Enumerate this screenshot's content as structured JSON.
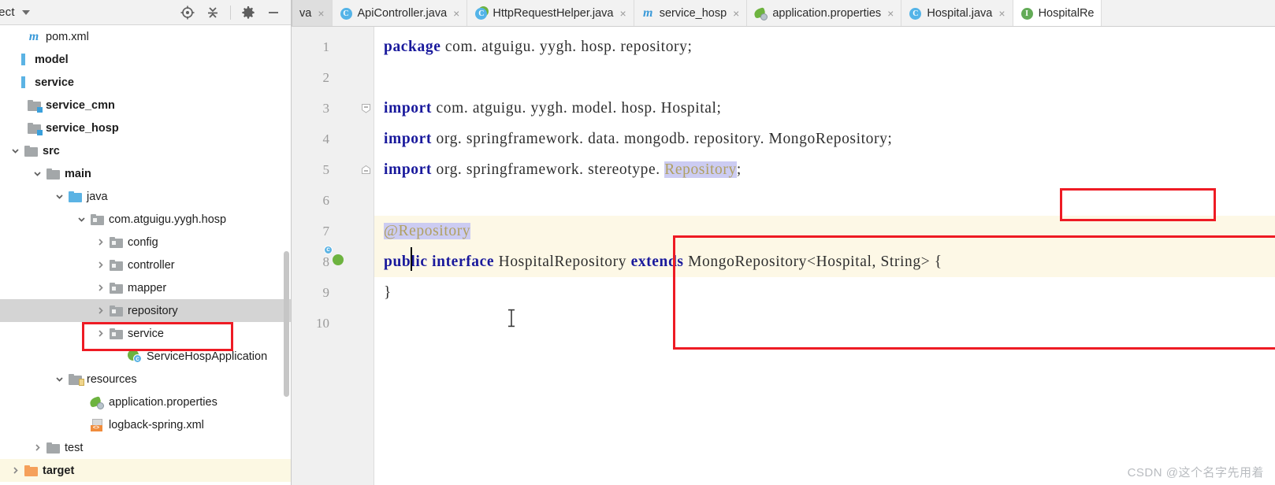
{
  "project_panel": {
    "title": "oject",
    "tools": [
      {
        "name": "locate-icon",
        "label": "Select Opened File"
      },
      {
        "name": "collapse-all-icon",
        "label": "Collapse All"
      },
      {
        "name": "settings-icon",
        "label": "Settings"
      },
      {
        "name": "hide-icon",
        "label": "Hide"
      }
    ],
    "tree": [
      {
        "label": "pom.xml",
        "icon": "maven-file-icon",
        "indent": 14,
        "arrow": "none",
        "bold": false,
        "state": "normal"
      },
      {
        "label": "model",
        "icon": "module-icon",
        "indent": -4,
        "arrow": "none",
        "bold": true,
        "state": "normal"
      },
      {
        "label": "service",
        "icon": "module-icon",
        "indent": -4,
        "arrow": "none",
        "bold": true,
        "state": "normal"
      },
      {
        "label": "service_cmn",
        "icon": "folder-module-icon",
        "indent": 14,
        "arrow": "none",
        "bold": true,
        "state": "normal"
      },
      {
        "label": "service_hosp",
        "icon": "folder-module-icon",
        "indent": 14,
        "arrow": "none",
        "bold": true,
        "state": "normal"
      },
      {
        "label": "src",
        "icon": "folder-icon",
        "indent": 10,
        "arrow": "down",
        "bold": true,
        "state": "normal"
      },
      {
        "label": "main",
        "icon": "folder-icon",
        "indent": 38,
        "arrow": "down",
        "bold": true,
        "state": "normal"
      },
      {
        "label": "java",
        "icon": "folder-source-icon",
        "indent": 66,
        "arrow": "down",
        "bold": false,
        "state": "normal"
      },
      {
        "label": "com.atguigu.yygh.hosp",
        "icon": "package-icon",
        "indent": 94,
        "arrow": "down",
        "bold": false,
        "state": "normal"
      },
      {
        "label": "config",
        "icon": "package-icon",
        "indent": 118,
        "arrow": "right",
        "bold": false,
        "state": "normal"
      },
      {
        "label": "controller",
        "icon": "package-icon",
        "indent": 118,
        "arrow": "right",
        "bold": false,
        "state": "normal"
      },
      {
        "label": "mapper",
        "icon": "package-icon",
        "indent": 118,
        "arrow": "right",
        "bold": false,
        "state": "normal"
      },
      {
        "label": "repository",
        "icon": "package-icon",
        "indent": 118,
        "arrow": "right",
        "bold": false,
        "state": "selected"
      },
      {
        "label": "service",
        "icon": "package-icon",
        "indent": 118,
        "arrow": "right",
        "bold": false,
        "state": "normal"
      },
      {
        "label": "ServiceHospApplication",
        "icon": "spring-boot-icon",
        "indent": 142,
        "arrow": "none",
        "bold": false,
        "state": "normal"
      },
      {
        "label": "resources",
        "icon": "folder-resource-icon",
        "indent": 66,
        "arrow": "down",
        "bold": false,
        "state": "normal"
      },
      {
        "label": "application.properties",
        "icon": "spring-leaf-icon",
        "indent": 94,
        "arrow": "none",
        "bold": false,
        "state": "normal"
      },
      {
        "label": "logback-spring.xml",
        "icon": "xml-file-icon",
        "indent": 94,
        "arrow": "none",
        "bold": false,
        "state": "normal"
      },
      {
        "label": "test",
        "icon": "folder-icon",
        "indent": 38,
        "arrow": "right",
        "bold": false,
        "state": "normal"
      },
      {
        "label": "target",
        "icon": "folder-target-icon",
        "indent": 10,
        "arrow": "right",
        "bold": true,
        "state": "target"
      }
    ]
  },
  "editor": {
    "tabs": [
      {
        "label": "va",
        "icon": "none",
        "active": false,
        "clipped": true,
        "closable": true
      },
      {
        "label": "ApiController.java",
        "icon": "class-icon",
        "active": false,
        "clipped": false,
        "closable": true
      },
      {
        "label": "HttpRequestHelper.java",
        "icon": "class-run-icon",
        "active": false,
        "clipped": false,
        "closable": true
      },
      {
        "label": "service_hosp",
        "icon": "maven-file-icon",
        "active": false,
        "clipped": false,
        "closable": true
      },
      {
        "label": "application.properties",
        "icon": "spring-leaf-icon",
        "active": false,
        "clipped": false,
        "closable": true
      },
      {
        "label": "Hospital.java",
        "icon": "class-icon",
        "active": false,
        "clipped": false,
        "closable": true
      },
      {
        "label": "HospitalRe",
        "icon": "interface-icon",
        "active": true,
        "clipped": false,
        "closable": false
      }
    ],
    "class_icon_letter": "C",
    "interface_icon_letter": "I",
    "code_lines": [
      {
        "num": "1",
        "highlight": false,
        "fold": "none",
        "gutter_icon": "none",
        "segments": [
          {
            "t": "package",
            "s": "kw"
          },
          {
            "t": " com. atguigu. yygh. hosp. repository;",
            "s": ""
          }
        ]
      },
      {
        "num": "2",
        "highlight": false,
        "fold": "none",
        "gutter_icon": "none",
        "segments": []
      },
      {
        "num": "3",
        "highlight": false,
        "fold": "start",
        "gutter_icon": "none",
        "segments": [
          {
            "t": "import",
            "s": "kw"
          },
          {
            "t": " com. atguigu. yygh. model. hosp. Hospital;",
            "s": ""
          }
        ]
      },
      {
        "num": "4",
        "highlight": false,
        "fold": "none",
        "gutter_icon": "none",
        "segments": [
          {
            "t": "import",
            "s": "kw"
          },
          {
            "t": " org. springframework. data. mongodb. repository. MongoRepository;",
            "s": ""
          }
        ]
      },
      {
        "num": "5",
        "highlight": false,
        "fold": "end",
        "gutter_icon": "none",
        "segments": [
          {
            "t": "import",
            "s": "kw"
          },
          {
            "t": " org. springframework. stereotyp",
            "s": ""
          },
          {
            "t": "e. ",
            "s": ""
          },
          {
            "t": "Repository",
            "s": "sel-lav annot-txt"
          },
          {
            "t": ";",
            "s": ""
          }
        ]
      },
      {
        "num": "6",
        "highlight": false,
        "fold": "none",
        "gutter_icon": "none",
        "segments": []
      },
      {
        "num": "7",
        "highlight": true,
        "fold": "none",
        "gutter_icon": "none",
        "segments": [
          {
            "t": "@Repository",
            "s": "sel-lav annot-txt"
          }
        ]
      },
      {
        "num": "8",
        "highlight": true,
        "fold": "none",
        "gutter_icon": "spring-boot-icon",
        "segments": [
          {
            "t": "public",
            "s": "kw"
          },
          {
            "t": " ",
            "s": ""
          },
          {
            "t": "interface",
            "s": "kw"
          },
          {
            "t": " HospitalRepository ",
            "s": ""
          },
          {
            "t": "extends",
            "s": "kw"
          },
          {
            "t": " MongoRepository<Hospital, String> ",
            "s": ""
          },
          {
            "t": "{",
            "s": ""
          }
        ]
      },
      {
        "num": "9",
        "highlight": false,
        "fold": "none",
        "gutter_icon": "none",
        "segments": [
          {
            "t": "}",
            "s": ""
          }
        ]
      },
      {
        "num": "10",
        "highlight": false,
        "fold": "none",
        "gutter_icon": "none",
        "segments": []
      }
    ]
  },
  "watermark": "CSDN @这个名字先用着",
  "colors": {
    "annotation_red": "#ee1b24",
    "keyword_blue": "#19199c",
    "selection_lavender": "#ccccf2",
    "line_highlight": "#fdf8e6",
    "tree_selection": "#d4d4d4"
  }
}
